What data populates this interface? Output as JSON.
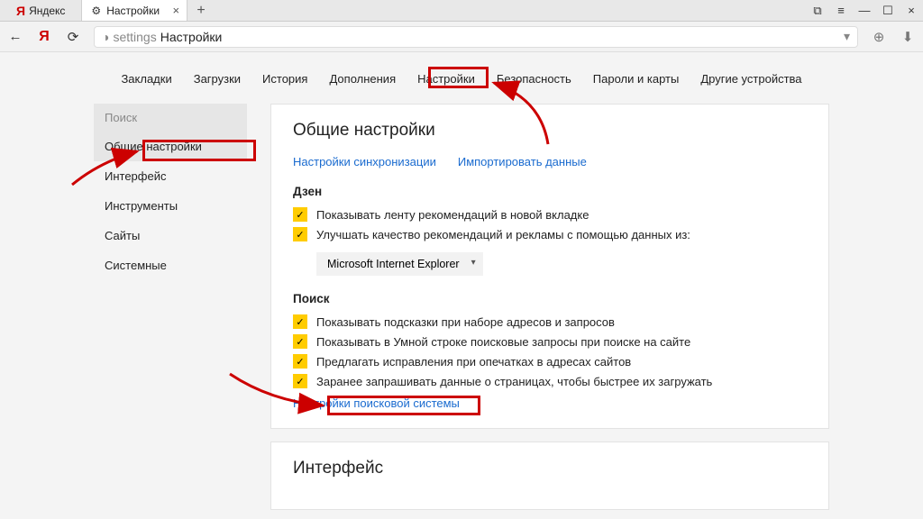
{
  "titlebar": {
    "tab1": "Яндекс",
    "tab2": "Настройки"
  },
  "addrbar": {
    "url_prefix": "settings",
    "url_label": "Настройки"
  },
  "topnav": {
    "bookmarks": "Закладки",
    "downloads": "Загрузки",
    "history": "История",
    "addons": "Дополнения",
    "settings": "Настройки",
    "security": "Безопасность",
    "passwords": "Пароли и карты",
    "devices": "Другие устройства"
  },
  "sidebar": {
    "search_placeholder": "Поиск",
    "items": {
      "general": "Общие настройки",
      "interface": "Интерфейс",
      "tools": "Инструменты",
      "sites": "Сайты",
      "system": "Системные"
    }
  },
  "content": {
    "general_heading": "Общие настройки",
    "sync_link": "Настройки синхронизации",
    "import_link": "Импортировать данные",
    "zen_heading": "Дзен",
    "zen_show_feed": "Показывать ленту рекомендаций в новой вкладке",
    "zen_improve": "Улучшать качество рекомендаций и рекламы с помощью данных из:",
    "zen_browser_select": "Microsoft Internet Explorer",
    "search_heading": "Поиск",
    "search_suggest": "Показывать подсказки при наборе адресов и запросов",
    "search_smartline": "Показывать в Умной строке поисковые запросы при поиске на сайте",
    "search_typos": "Предлагать исправления при опечатках в адресах сайтов",
    "search_preload": "Заранее запрашивать данные о страницах, чтобы быстрее их загружать",
    "search_engine_link": "Настройки поисковой системы",
    "interface_heading": "Интерфейс"
  }
}
